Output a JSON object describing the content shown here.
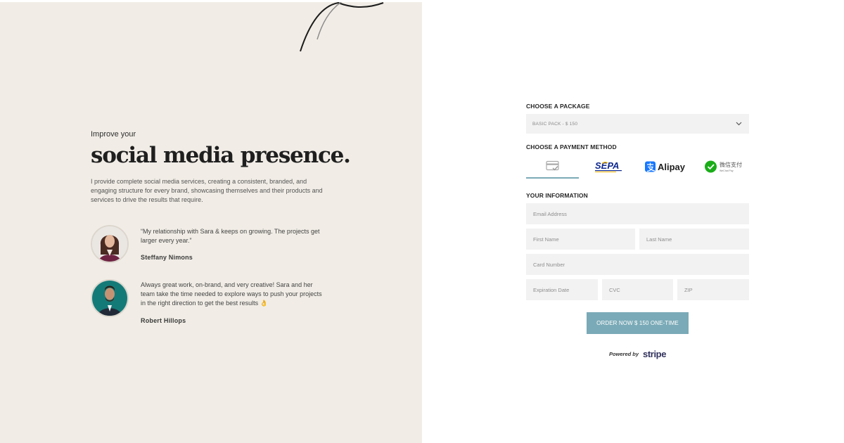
{
  "hero": {
    "eyebrow": "Improve your",
    "headline": "social media presence.",
    "description": "I provide complete social media services, creating a consistent, branded, and engaging structure for every brand, showcasing themselves and their products and services to drive the results that require."
  },
  "testimonials": [
    {
      "quote": "“My relationship with Sara & keeps on growing. The projects get larger every year.”",
      "author": "Steffany Nimons"
    },
    {
      "quote": "Always great work, on-brand, and very creative! Sara and her team take the time needed to explore ways to push your projects in the right direction to get the best results 👌",
      "author": "Robert Hillops"
    }
  ],
  "form": {
    "package_label": "CHOOSE A PACKAGE",
    "package_value": "BASIC PACK - $ 150",
    "payment_label": "CHOOSE A PAYMENT METHOD",
    "payment_methods": [
      {
        "name": "card",
        "icon": "credit-card-icon",
        "selected": true
      },
      {
        "name": "SEPA",
        "icon": "sepa-logo"
      },
      {
        "name": "Alipay",
        "icon": "alipay-logo"
      },
      {
        "name": "WeChat Pay",
        "icon": "wechat-pay-logo",
        "label_cn": "微信支付",
        "label_en": "WeChat Pay"
      }
    ],
    "info_label": "YOUR INFORMATION",
    "fields": {
      "email": "Email Address",
      "first_name": "First Name",
      "last_name": "Last Name",
      "card_number": "Card Number",
      "expiration": "Expiration Date",
      "cvc": "CVC",
      "zip": "ZIP"
    },
    "submit_label": "ORDER NOW $ 150 ONE-TIME",
    "powered_by": "Powered by",
    "stripe": "stripe"
  },
  "colors": {
    "left_panel_bg": "#f1ede6",
    "accent": "#7aaab7",
    "field_bg": "#f2f2f2",
    "alipay_blue": "#1677ff",
    "wechat_green": "#1aad19",
    "sepa_navy": "#10298e"
  }
}
